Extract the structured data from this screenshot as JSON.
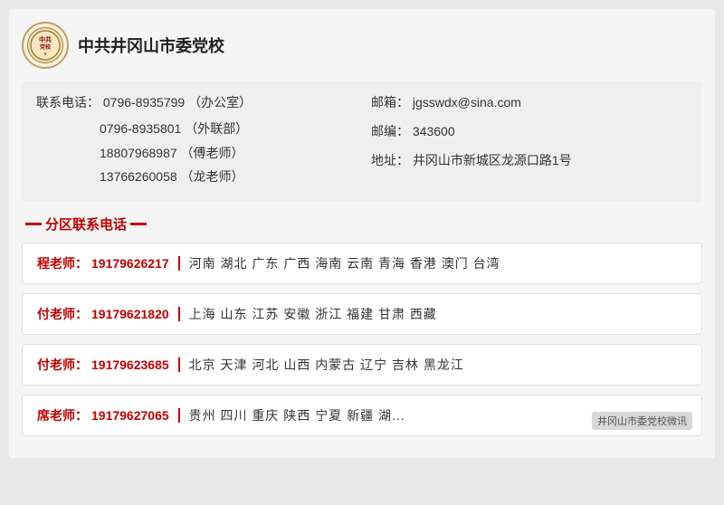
{
  "header": {
    "logo_text": "党校",
    "org_name": "中共井冈山市委党校"
  },
  "contact": {
    "phone_label": "联系电话：",
    "phones": [
      {
        "number": "0796-8935799",
        "note": "（办公室）"
      },
      {
        "number": "0796-8935801",
        "note": "（外联部）"
      },
      {
        "number": "18807968987",
        "note": "（傅老师）"
      },
      {
        "number": "13766260058",
        "note": "（龙老师）"
      }
    ],
    "email_label": "邮箱：",
    "email": "jgsswdx@sina.com",
    "postcode_label": "邮编：",
    "postcode": "343600",
    "address_label": "地址：",
    "address": "井冈山市新城区龙源口路1号"
  },
  "section_title": "分区联系电话",
  "regions": [
    {
      "teacher": "程老师：",
      "phone": "19179626217",
      "areas": "河南  湖北  广东  广西  海南  云南  青海  香港  澳门  台湾"
    },
    {
      "teacher": "付老师：",
      "phone": "19179621820",
      "areas": "上海  山东  江苏  安徽  浙江  福建  甘肃  西藏"
    },
    {
      "teacher": "付老师：",
      "phone": "19179623685",
      "areas": "北京  天津  河北  山西  内蒙古  辽宁  吉林  黑龙江"
    },
    {
      "teacher": "席老师：",
      "phone": "19179627065",
      "areas": "贵州  四川  重庆  陕西  宁夏  新疆  湖..."
    }
  ],
  "watermark": "井冈山市委党校微讯"
}
